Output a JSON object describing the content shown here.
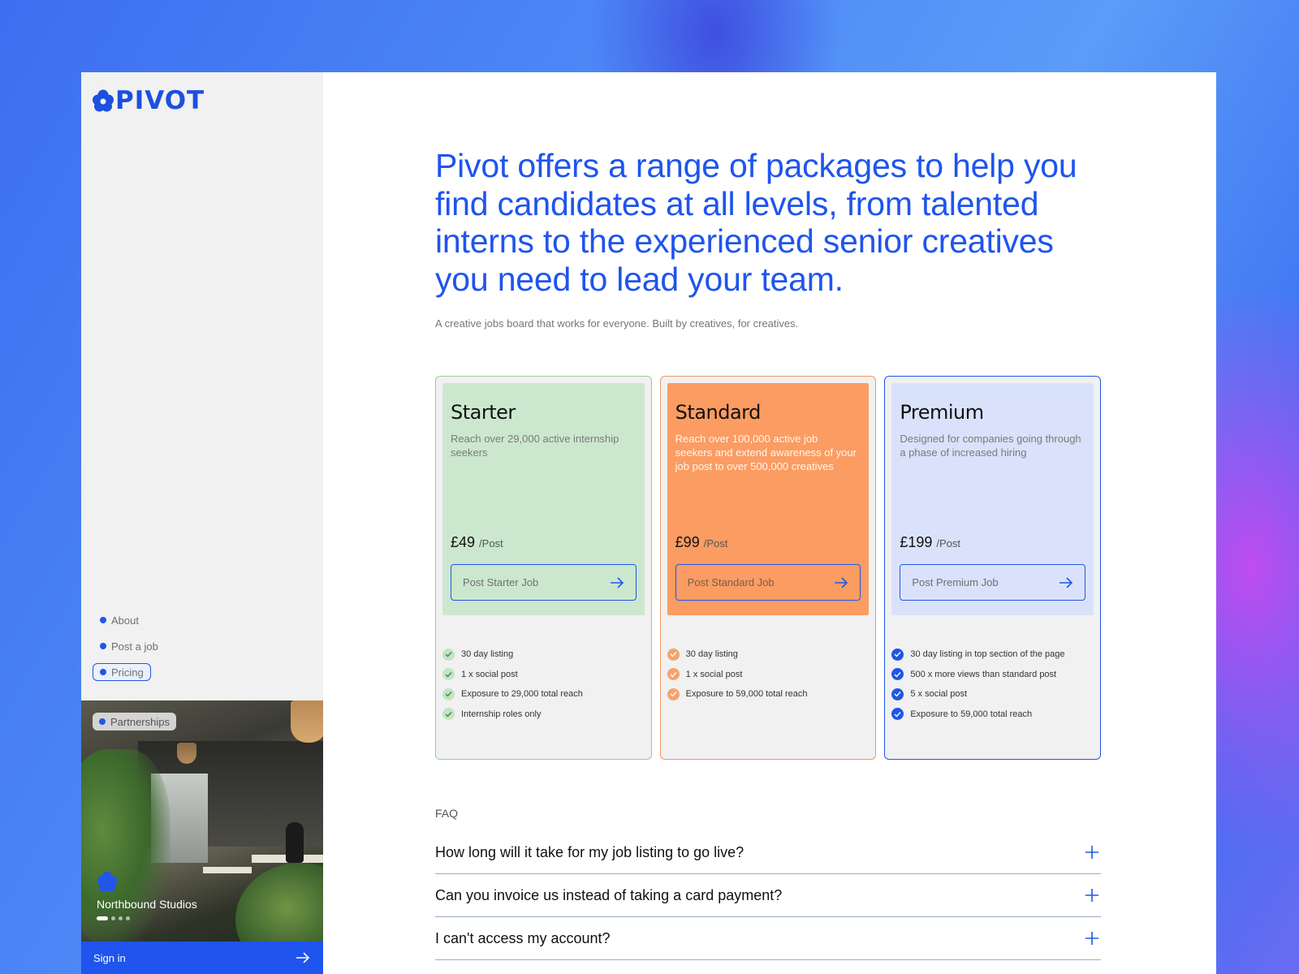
{
  "brand": {
    "name": "PIVOT",
    "accent": "#1f54ee"
  },
  "sidebar": {
    "nav": [
      {
        "label": "About",
        "active": false
      },
      {
        "label": "Post a job",
        "active": false
      },
      {
        "label": "Pricing",
        "active": true
      }
    ],
    "promo": {
      "badge": "Partnerships",
      "company": "Northbound Studios",
      "slides": 4,
      "current_slide": 1
    },
    "signin_label": "Sign in"
  },
  "main": {
    "headline": "Pivot offers a range of packages to help you find candidates at all levels, from talented interns to the experienced senior creatives you need to lead your team.",
    "subtitle": "A creative jobs board that works for everyone. Built by creatives, for creatives.",
    "plans": [
      {
        "name": "Starter",
        "description": "Reach over 29,000 active internship seekers",
        "price": "£49",
        "period": "/Post",
        "cta": "Post Starter Job",
        "features": [
          "30 day listing",
          "1 x social post",
          "Exposure to 29,000 total reach",
          "Internship roles only"
        ],
        "color": "#8fd29a"
      },
      {
        "name": "Standard",
        "description": "Reach over 100,000 active job seekers and extend awareness of your job post to over 500,000 creatives",
        "price": "£99",
        "period": "/Post",
        "cta": "Post Standard Job",
        "features": [
          "30 day listing",
          "1 x social post",
          "Exposure to 59,000 total reach"
        ],
        "color": "#fb9c63"
      },
      {
        "name": "Premium",
        "description": "Designed for companies going through a phase of increased hiring",
        "price": "£199",
        "period": "/Post",
        "cta": "Post Premium Job",
        "features": [
          "30 day listing in top section of the page",
          "500 x more views than standard post",
          "5 x social post",
          "Exposure to 59,000 total reach"
        ],
        "color": "#2156e8"
      }
    ],
    "faq": {
      "label": "FAQ",
      "questions": [
        "How long will it take for my job listing to go live?",
        "Can you invoice us instead of taking a card payment?",
        "I can't access my account?"
      ]
    }
  }
}
